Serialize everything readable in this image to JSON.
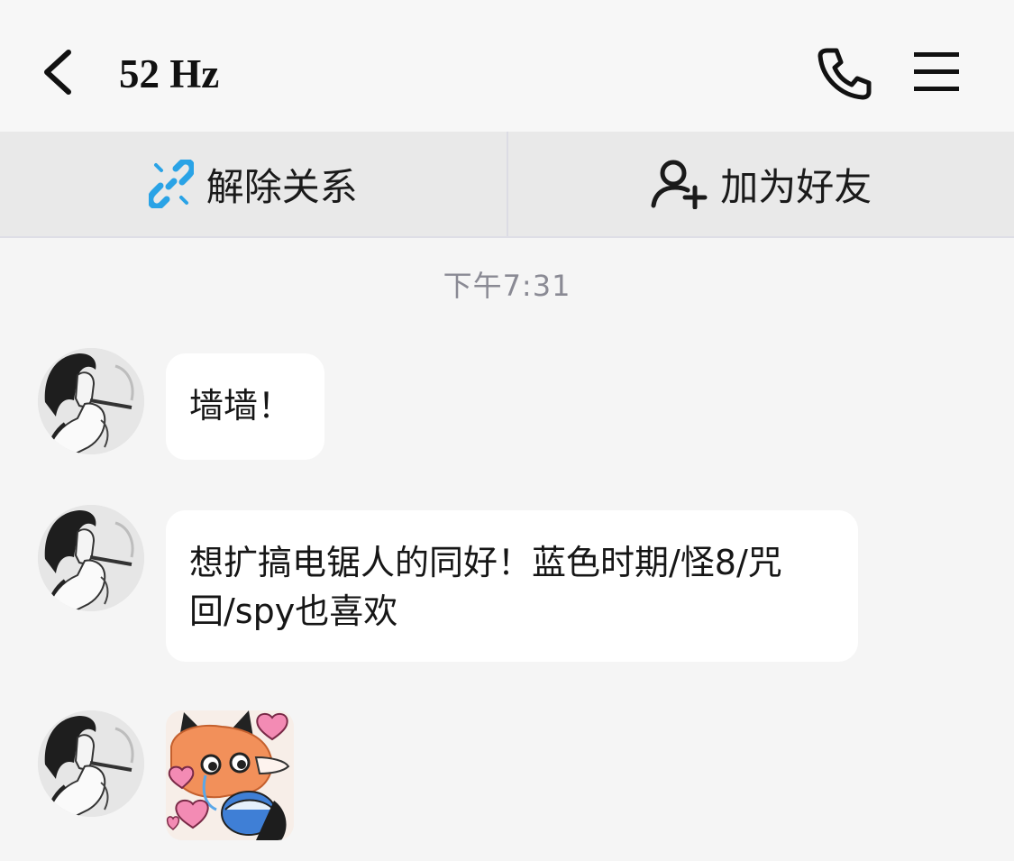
{
  "header": {
    "title": "52 Hz",
    "back_icon": "chevron-left-icon",
    "call_icon": "phone-icon",
    "menu_icon": "hamburger-menu-icon"
  },
  "actions": [
    {
      "label": "解除关系",
      "icon": "unlink-icon",
      "icon_color": "#2aa3e6"
    },
    {
      "label": "加为好友",
      "icon": "add-user-icon",
      "icon_color": "#1a1a1a"
    }
  ],
  "chat": {
    "timestamp": "下午7:31",
    "messages": [
      {
        "type": "text",
        "text": "墙墙！"
      },
      {
        "type": "text",
        "text": "想扩搞电锯人的同好！蓝色时期/怪8/咒回/spy也喜欢"
      },
      {
        "type": "sticker",
        "sticker": "fox-hearts-sticker"
      }
    ]
  },
  "colors": {
    "background": "#f5f5f5",
    "bubble": "#ffffff",
    "timestamp": "#8a8a94",
    "unlink_accent": "#2aa3e6"
  }
}
